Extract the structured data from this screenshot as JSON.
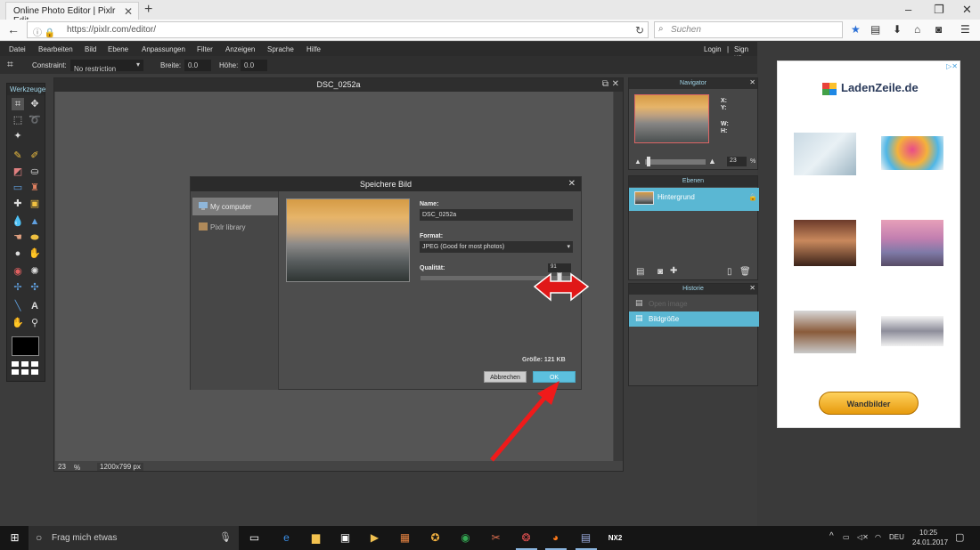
{
  "browser": {
    "tab_title": "Online Photo Editor | Pixlr Edit...",
    "url": "https://pixlr.com/editor/",
    "search_placeholder": "Suchen",
    "new_tab": "+",
    "win_controls": [
      "–",
      "❐",
      "✕"
    ]
  },
  "app": {
    "menu": [
      "Datei",
      "Bearbeiten",
      "Bild",
      "Ebene",
      "Anpassungen",
      "Filter",
      "Anzeigen",
      "Sprache",
      "Hilfe"
    ],
    "login": "Login",
    "separator": "|",
    "signup": "Sign up",
    "options": {
      "constraint_label": "Constraint:",
      "constraint_value": "No restriction",
      "width_label": "Breite:",
      "width_value": "0.0",
      "height_label": "Höhe:",
      "height_value": "0.0"
    },
    "toolbox_title": "Werkzeuge",
    "document": {
      "title": "DSC_0252a",
      "zoom": "23",
      "zoom_unit": "%",
      "dimensions": "1200x799 px"
    }
  },
  "dialog": {
    "title": "Speichere Bild",
    "sources": [
      "My computer",
      "Pixlr library"
    ],
    "name_label": "Name:",
    "name_value": "DSC_0252a",
    "format_label": "Format:",
    "format_value": "JPEG (Good for most photos)",
    "quality_label": "Qualität:",
    "quality_value": "91",
    "size_text": "Größe: 121 KB",
    "cancel_label": "Abbrechen",
    "ok_label": "OK"
  },
  "panels": {
    "navigator": {
      "title": "Navigator",
      "x_label": "X:",
      "y_label": "Y:",
      "w_label": "W:",
      "h_label": "H:",
      "zoom": "23",
      "zoom_unit": "%"
    },
    "layers": {
      "title": "Ebenen",
      "layer_name": "Hintergrund"
    },
    "history": {
      "title": "Historie",
      "items": [
        "Open image",
        "Bildgröße"
      ]
    }
  },
  "ad": {
    "brand": "LadenZeile.de",
    "button": "Wandbilder"
  },
  "taskbar": {
    "search": "Frag mich etwas",
    "lang": "DEU",
    "time": "10:25",
    "date": "24.01.2017"
  }
}
